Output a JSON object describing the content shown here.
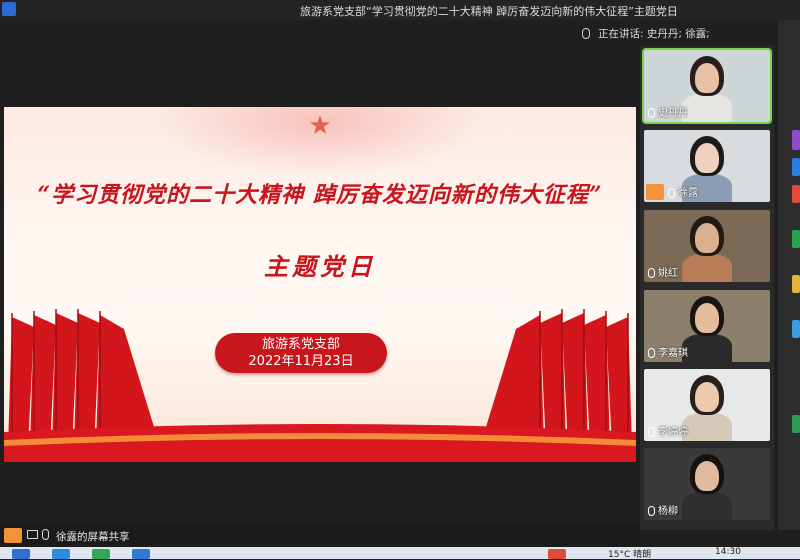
{
  "window": {
    "title": "旅游系党支部“学习贯彻党的二十大精神 踔厉奋发迈向新的伟大征程”主题党日"
  },
  "meeting": {
    "speaking_label": "正在讲话: 史丹丹; 徐露;"
  },
  "slide": {
    "main_title": "“学习贯彻党的二十大精神 踔厉奋发迈向新的伟大征程”",
    "sub_title": "主题党日",
    "org": "旅游系党支部",
    "date": "2022年11月23日"
  },
  "participants": [
    {
      "name": "史丹丹",
      "bg": "#cfd6d8",
      "skin": "#e8c1a8",
      "hair": "#2a1e1a",
      "shirt": "#e8e6e2"
    },
    {
      "name": "徐露",
      "bg": "#d9dcdf",
      "skin": "#f0d0c0",
      "hair": "#1e1a18",
      "shirt": "#8a9fb5",
      "avatar": true
    },
    {
      "name": "姚红",
      "bg": "#7b6a55",
      "skin": "#d9b090",
      "hair": "#241a14",
      "shirt": "#b87d56"
    },
    {
      "name": "李嘉琪",
      "bg": "#8c7f6c",
      "skin": "#e3bd9e",
      "hair": "#1b1512",
      "shirt": "#2b2b2b"
    },
    {
      "name": "李婷婷",
      "bg": "#e7e8e9",
      "skin": "#edc9b0",
      "hair": "#2a1f1a",
      "shirt": "#d7c9b8"
    },
    {
      "name": "杨柳",
      "bg": "#3a3a3a",
      "skin": "#e0bba0",
      "hair": "#161210",
      "shirt": "#2e2e2e"
    }
  ],
  "share_bar": {
    "label": "徐露的屏幕共享"
  },
  "taskbar": {
    "time": "14:30",
    "weather": "15°C 晴朗"
  }
}
